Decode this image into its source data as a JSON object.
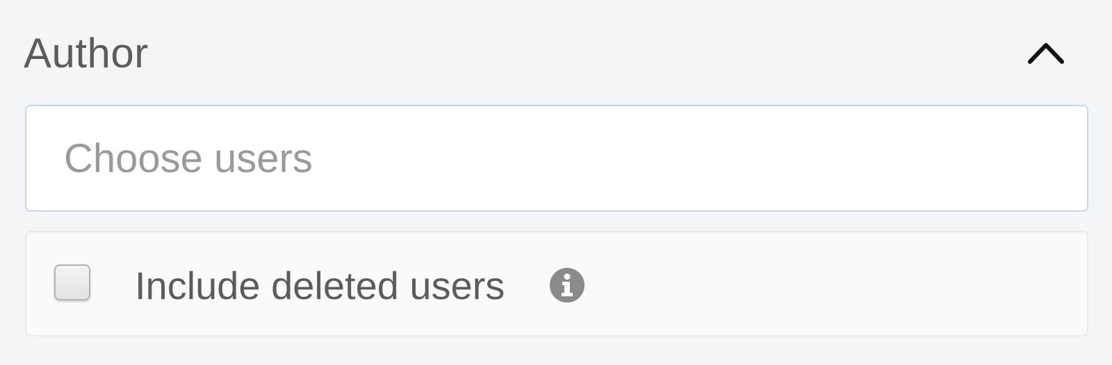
{
  "author_filter": {
    "title": "Author",
    "toggle_icon": "chevron-up-icon",
    "user_select": {
      "placeholder": "Choose users",
      "value": ""
    },
    "include_deleted": {
      "label": "Include deleted users",
      "checked": false,
      "info_icon": "info-icon"
    }
  },
  "colors": {
    "background": "#f4f5f7",
    "text": "#5c5c5c",
    "placeholder": "#9a9a9a",
    "input_border": "#c9d6e6",
    "icon_gray": "#8a8a8a"
  }
}
